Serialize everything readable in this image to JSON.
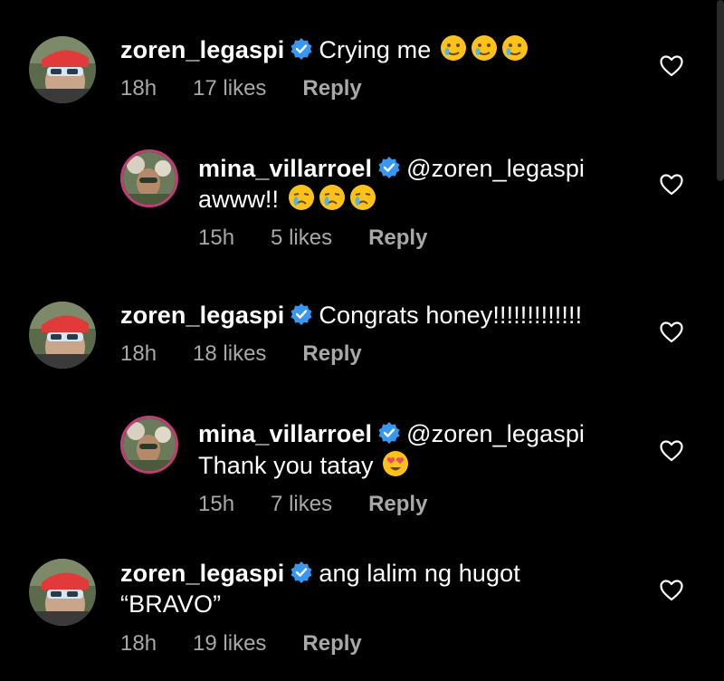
{
  "comments": [
    {
      "username": "zoren_legaspi",
      "text_line1": "Crying me",
      "text_line2": "",
      "time": "18h",
      "likes": "17 likes",
      "reply": "Reply",
      "emoji": "teary-smile-emoji"
    },
    {
      "username": "mina_villarroel",
      "text_line1": "@zoren_legaspi",
      "text_line2": "awww!!",
      "time": "15h",
      "likes": "5 likes",
      "reply": "Reply",
      "emoji": "crying-face-emoji"
    },
    {
      "username": "zoren_legaspi",
      "text_line1": "Congrats honey!!!!!!!!!!!!!",
      "text_line2": "",
      "time": "18h",
      "likes": "18 likes",
      "reply": "Reply"
    },
    {
      "username": "mina_villarroel",
      "text_line1": "@zoren_legaspi",
      "text_line2": "Thank you tatay",
      "time": "15h",
      "likes": "7 likes",
      "reply": "Reply",
      "emoji": "heart-eyes-emoji"
    },
    {
      "username": "zoren_legaspi",
      "text_line1": "ang lalim ng hugot",
      "text_line2": "“BRAVO”",
      "time": "18h",
      "likes": "19 likes",
      "reply": "Reply"
    }
  ],
  "colors": {
    "background": "#000000",
    "text": "#ffffff",
    "meta": "#a8a8a8",
    "verified": "#3897f0",
    "story_ring": "#c43b7a"
  }
}
